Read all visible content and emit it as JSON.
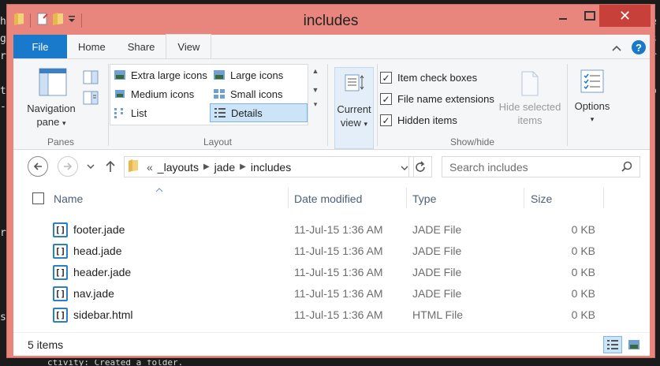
{
  "background_fragments": [
    {
      "text": "h"
    },
    {
      "text": "g"
    },
    {
      "text": "r"
    },
    {
      "text": "t"
    },
    {
      "text": "-"
    },
    {
      "text": "r"
    },
    {
      "text": "s"
    },
    {
      "text": "e"
    },
    {
      "text": "s"
    },
    {
      "text": "r"
    },
    {
      "text": "o"
    },
    {
      "text": "-"
    },
    {
      "text": "ctivity: Created a folder."
    }
  ],
  "window": {
    "title": "includes",
    "close_glyph": "✕"
  },
  "ribbon_tabs": {
    "file": "File",
    "home": "Home",
    "share": "Share",
    "view": "View"
  },
  "ribbon": {
    "panes": {
      "nav_pane": "Navigation",
      "nav_pane2": "pane",
      "group": "Panes"
    },
    "layout": {
      "items": [
        "Extra large icons",
        "Large icons",
        "Medium icons",
        "Small icons",
        "List",
        "Details"
      ],
      "selected": "Details",
      "group": "Layout"
    },
    "current_view": {
      "line1": "Current",
      "line2": "view"
    },
    "showhide": {
      "item_check_boxes": "Item check boxes",
      "file_name_extensions": "File name extensions",
      "hidden_items": "Hidden items",
      "hide_selected_1": "Hide selected",
      "hide_selected_2": "items",
      "group": "Show/hide"
    },
    "options": "Options",
    "checked": "✓"
  },
  "address": {
    "prefix": "«",
    "crumbs": [
      "_layouts",
      "jade",
      "includes"
    ],
    "search_placeholder": "Search includes"
  },
  "columns": {
    "name": "Name",
    "date": "Date modified",
    "type": "Type",
    "size": "Size"
  },
  "files": [
    {
      "name": "footer.jade",
      "date": "11-Jul-15 1:36 AM",
      "type": "JADE File",
      "size": "0 KB",
      "icon": "[]"
    },
    {
      "name": "head.jade",
      "date": "11-Jul-15 1:36 AM",
      "type": "JADE File",
      "size": "0 KB",
      "icon": "[]"
    },
    {
      "name": "header.jade",
      "date": "11-Jul-15 1:36 AM",
      "type": "JADE File",
      "size": "0 KB",
      "icon": "[]"
    },
    {
      "name": "nav.jade",
      "date": "11-Jul-15 1:36 AM",
      "type": "JADE File",
      "size": "0 KB",
      "icon": "[]"
    },
    {
      "name": "sidebar.html",
      "date": "11-Jul-15 1:36 AM",
      "type": "HTML File",
      "size": "0 KB",
      "icon": "[]"
    }
  ],
  "status": {
    "count": "5 items"
  },
  "colors": {
    "accent": "#1979ca",
    "titlebar": "#e8857d",
    "close": "#c7413a"
  }
}
